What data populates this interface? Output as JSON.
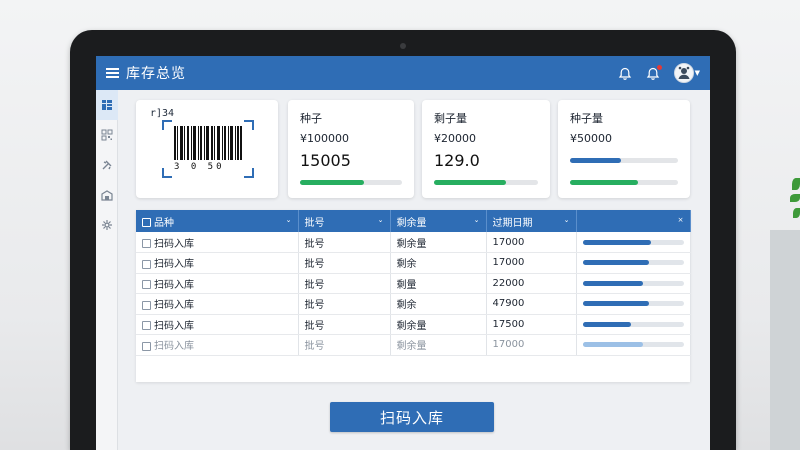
{
  "app": {
    "title": "库存总览",
    "accent": "#2f6db5",
    "icons": [
      "menu-icon",
      "bell-icon",
      "notification-bell-icon",
      "avatar",
      "chevron-down-icon"
    ]
  },
  "sidebar": {
    "items": [
      {
        "icon": "dashboard-icon"
      },
      {
        "icon": "qr-code-icon"
      },
      {
        "icon": "tools-icon"
      },
      {
        "icon": "warehouse-icon"
      },
      {
        "icon": "settings-icon"
      }
    ]
  },
  "barcode_card": {
    "label": "r]34",
    "digits": "3  0 50"
  },
  "stats": [
    {
      "title": "种子",
      "sub": "¥100000",
      "value": "15005",
      "progress": 0.63,
      "color": "#27ae60"
    },
    {
      "title": "剩子量",
      "sub": "¥20000",
      "value": "129.0",
      "progress": 0.69,
      "color": "#27ae60"
    },
    {
      "title": "种子量",
      "sub": "¥50000",
      "value": "",
      "progress": 0.47,
      "progress2": 0.63,
      "color": "#2f6db5",
      "color2": "#27ae60"
    }
  ],
  "table": {
    "headers": [
      "品种",
      "批号",
      "剩余量",
      "过期日期",
      ""
    ],
    "rows": [
      {
        "name": "扫码入库",
        "batch": "批号",
        "remain": "剩余量",
        "expiry": "17000",
        "level": 0.68,
        "faded": false
      },
      {
        "name": "扫码入库",
        "batch": "批号",
        "remain": "剩余",
        "expiry": "17000",
        "level": 0.66,
        "faded": false
      },
      {
        "name": "扫码入库",
        "batch": "批号",
        "remain": "剩量",
        "expiry": "22000",
        "level": 0.6,
        "faded": false
      },
      {
        "name": "扫码入库",
        "batch": "批号",
        "remain": "剩余",
        "expiry": "47900",
        "level": 0.66,
        "faded": false
      },
      {
        "name": "扫码入库",
        "batch": "批号",
        "remain": "剩余量",
        "expiry": "17500",
        "level": 0.48,
        "faded": false
      },
      {
        "name": "扫码入库",
        "batch": "批号",
        "remain": "剩余量",
        "expiry": "17000",
        "level": 0.6,
        "faded": true
      }
    ]
  },
  "actions": {
    "scan_label": "扫码入库"
  }
}
